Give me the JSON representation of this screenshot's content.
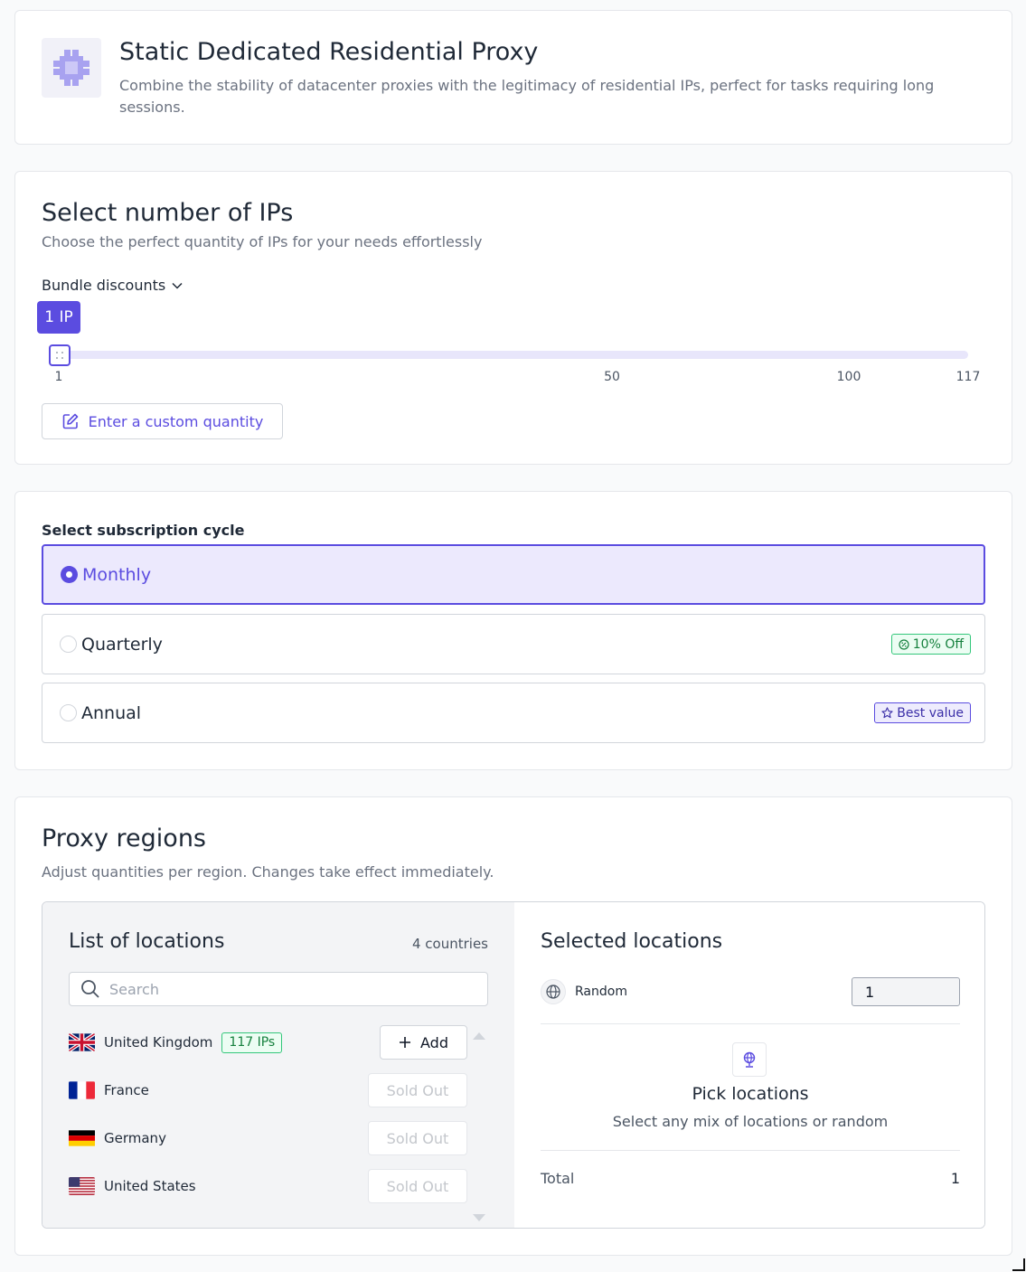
{
  "product": {
    "title": "Static Dedicated Residential Proxy",
    "description": "Combine the stability of datacenter proxies with the legitimacy of residential IPs, perfect for tasks requiring long sessions.",
    "icon": "proxy-chip-icon"
  },
  "ips": {
    "title": "Select number of IPs",
    "subtitle": "Choose the perfect quantity of IPs for your needs effortlessly",
    "bundle_label": "Bundle discounts",
    "tooltip": "1 IP",
    "slider_value": 1,
    "slider_min": 1,
    "slider_max": 117,
    "ticks": [
      "1",
      "50",
      "100",
      "117"
    ],
    "custom_button": "Enter a custom quantity"
  },
  "subscription": {
    "label": "Select subscription cycle",
    "options": [
      {
        "label": "Monthly",
        "selected": true,
        "badge": ""
      },
      {
        "label": "Quarterly",
        "selected": false,
        "badge": "10% Off"
      },
      {
        "label": "Annual",
        "selected": false,
        "badge": "Best value"
      }
    ]
  },
  "regions": {
    "title": "Proxy regions",
    "subtitle": "Adjust quantities per region. Changes take effect immediately.",
    "list_title": "List of locations",
    "count": "4 countries",
    "search_placeholder": "Search",
    "locations": [
      {
        "name": "United Kingdom",
        "badge": "117 IPs",
        "action": "Add"
      },
      {
        "name": "France",
        "badge": "",
        "action": "Sold Out"
      },
      {
        "name": "Germany",
        "badge": "",
        "action": "Sold Out"
      },
      {
        "name": "United States",
        "badge": "",
        "action": "Sold Out"
      }
    ],
    "selected_title": "Selected locations",
    "random_label": "Random",
    "random_qty": "1",
    "pick_title": "Pick locations",
    "pick_subtitle": "Select any mix of locations or random",
    "total_label": "Total",
    "total_value": "1"
  },
  "colors": {
    "accent": "#5b4ce0",
    "accent_light": "#ece9fd",
    "success": "#15803d"
  }
}
